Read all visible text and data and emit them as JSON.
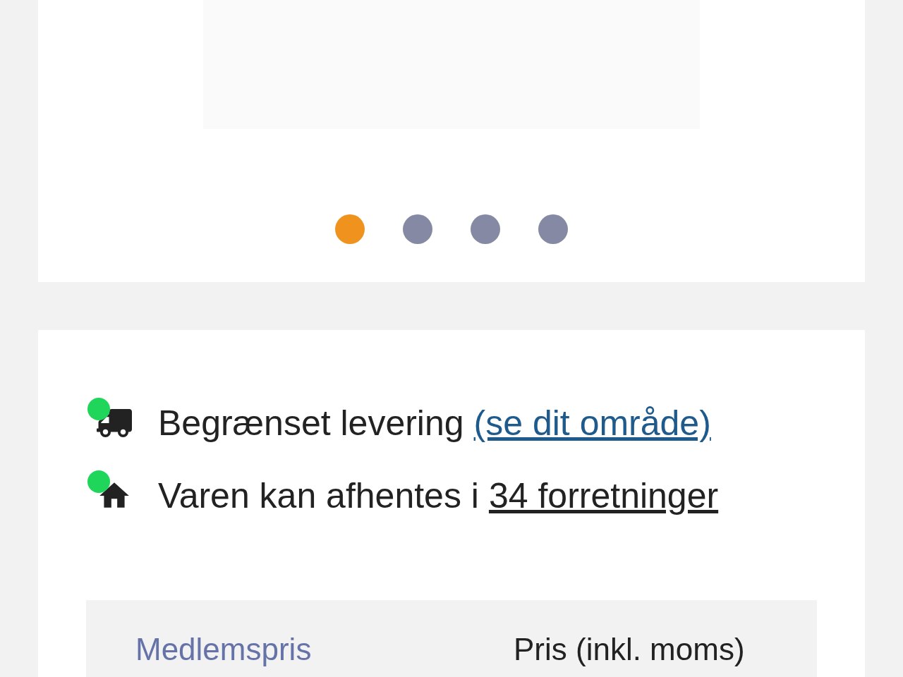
{
  "carousel": {
    "dots": [
      {
        "selected": true
      },
      {
        "selected": false
      },
      {
        "selected": false
      },
      {
        "selected": false
      }
    ]
  },
  "availability": [
    {
      "kind": "delivery",
      "available": true,
      "text": "Begrænset levering",
      "link": "(se dit område)"
    },
    {
      "kind": "pickup",
      "available": true,
      "text": "Varen kan afhentes i",
      "link": "34 forretninger"
    }
  ],
  "price_box": {
    "member_label": "Medlemspris",
    "price_label": "Pris (inkl. moms)"
  }
}
